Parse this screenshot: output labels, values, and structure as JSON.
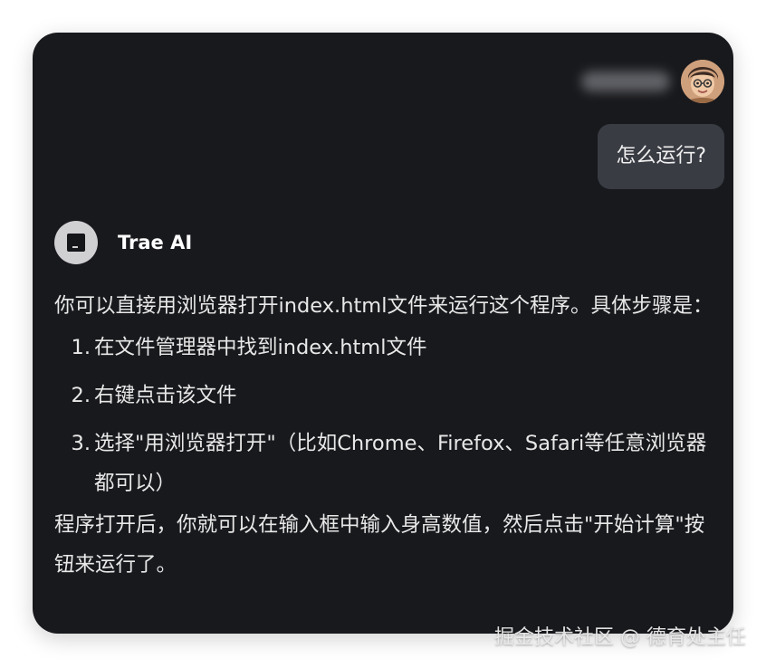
{
  "user": {
    "avatar_icon": "user-avatar-icon",
    "message": "怎么运行?"
  },
  "assistant": {
    "name": "Trae AI",
    "logo_icon": "trae-logo-icon",
    "intro": "你可以直接用浏览器打开index.html文件来运行这个程序。具体步骤是：",
    "steps": [
      {
        "num": "1.",
        "text": "在文件管理器中找到index.html文件"
      },
      {
        "num": "2.",
        "text": "右键点击该文件"
      },
      {
        "num": "3.",
        "text": "选择\"用浏览器打开\"（比如Chrome、Firefox、Safari等任意浏览器都可以）"
      }
    ],
    "outro": "程序打开后，你就可以在输入框中输入身高数值，然后点击\"开始计算\"按钮来运行了。"
  },
  "watermark": "掘金技术社区 @ 德育处主任",
  "colors": {
    "window_bg": "#18191d",
    "user_bubble_bg": "#3a3c44",
    "text": "#e8e8e8"
  }
}
